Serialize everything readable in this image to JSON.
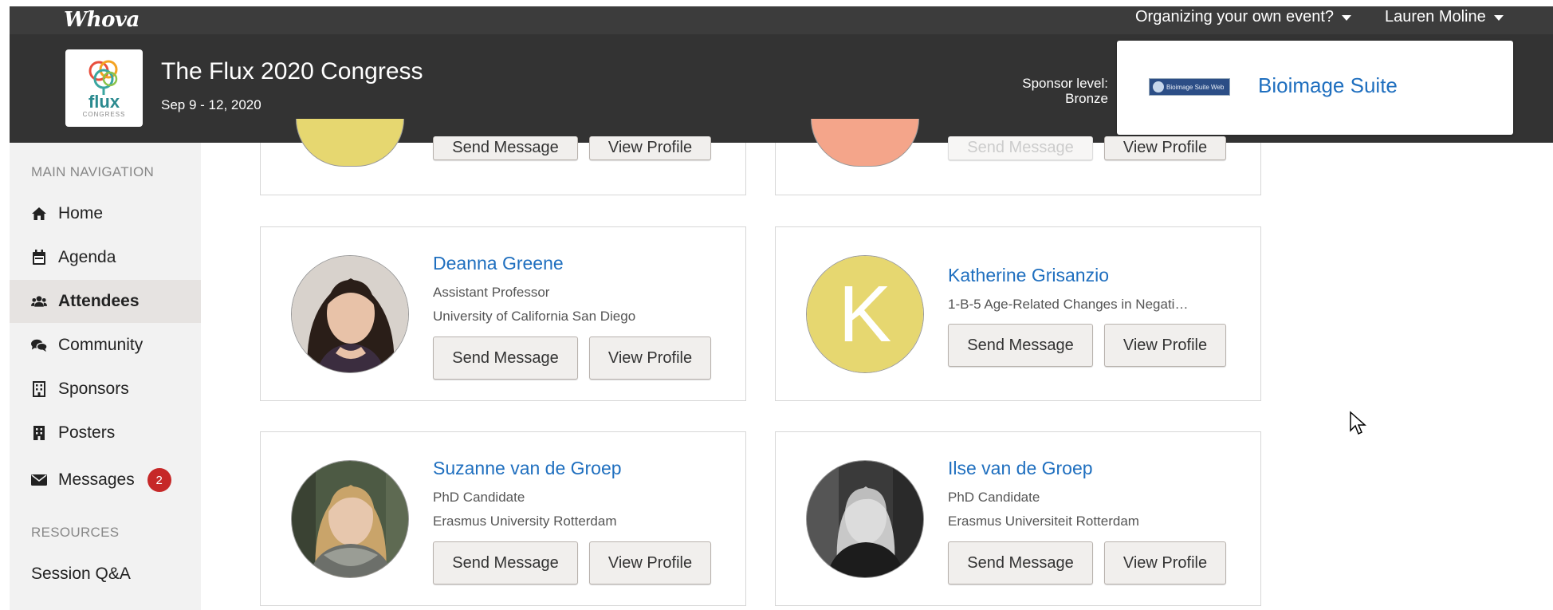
{
  "topbar": {
    "brand": "Whova",
    "organize_label": "Organizing your own event?",
    "user_name": "Lauren Moline"
  },
  "event": {
    "title": "The Flux 2020 Congress",
    "dates": "Sep 9 - 12, 2020",
    "logo_text": "flux",
    "logo_sub": "CONGRESS"
  },
  "sponsor": {
    "level_label": "Sponsor level:",
    "level_value": "Bronze",
    "name": "Bioimage Suite",
    "logo_text": "Bioimage Suite Web"
  },
  "sidebar": {
    "main_nav_label": "MAIN NAVIGATION",
    "items": [
      {
        "label": "Home",
        "icon": "home-icon"
      },
      {
        "label": "Agenda",
        "icon": "calendar-icon"
      },
      {
        "label": "Attendees",
        "icon": "users-icon",
        "active": true
      },
      {
        "label": "Community",
        "icon": "comments-icon"
      },
      {
        "label": "Sponsors",
        "icon": "building-icon"
      },
      {
        "label": "Posters",
        "icon": "poster-icon"
      },
      {
        "label": "Messages",
        "icon": "envelope-icon",
        "badge": "2"
      }
    ],
    "resources_label": "RESOURCES",
    "resources": [
      {
        "label": "Session Q&A"
      }
    ]
  },
  "buttons": {
    "send": "Send Message",
    "view": "View Profile"
  },
  "partial_cards": [
    {
      "send": "Send Message",
      "view": "View Profile",
      "avatar_color": "#e6d770"
    },
    {
      "send": "Send Message",
      "view": "View Profile",
      "avatar_color": "#f4a58a"
    }
  ],
  "attendees": [
    {
      "name": "Deanna Greene",
      "line1": "Assistant Professor",
      "line2": "University of California San Diego",
      "avatar": "photo"
    },
    {
      "name": "Katherine Grisanzio",
      "line1": "1-B-5 Age-Related Changes in Negati…",
      "line2": "",
      "avatar": "letter",
      "letter": "K"
    },
    {
      "name": "Suzanne van de Groep",
      "line1": "PhD Candidate",
      "line2": "Erasmus University Rotterdam",
      "avatar": "photo"
    },
    {
      "name": "Ilse van de Groep",
      "line1": "PhD Candidate",
      "line2": "Erasmus Universiteit Rotterdam",
      "avatar": "photo"
    }
  ],
  "colors": {
    "link": "#1f6fbf",
    "badge": "#c62828",
    "header": "#333333",
    "topbar": "#3c3c3c"
  }
}
